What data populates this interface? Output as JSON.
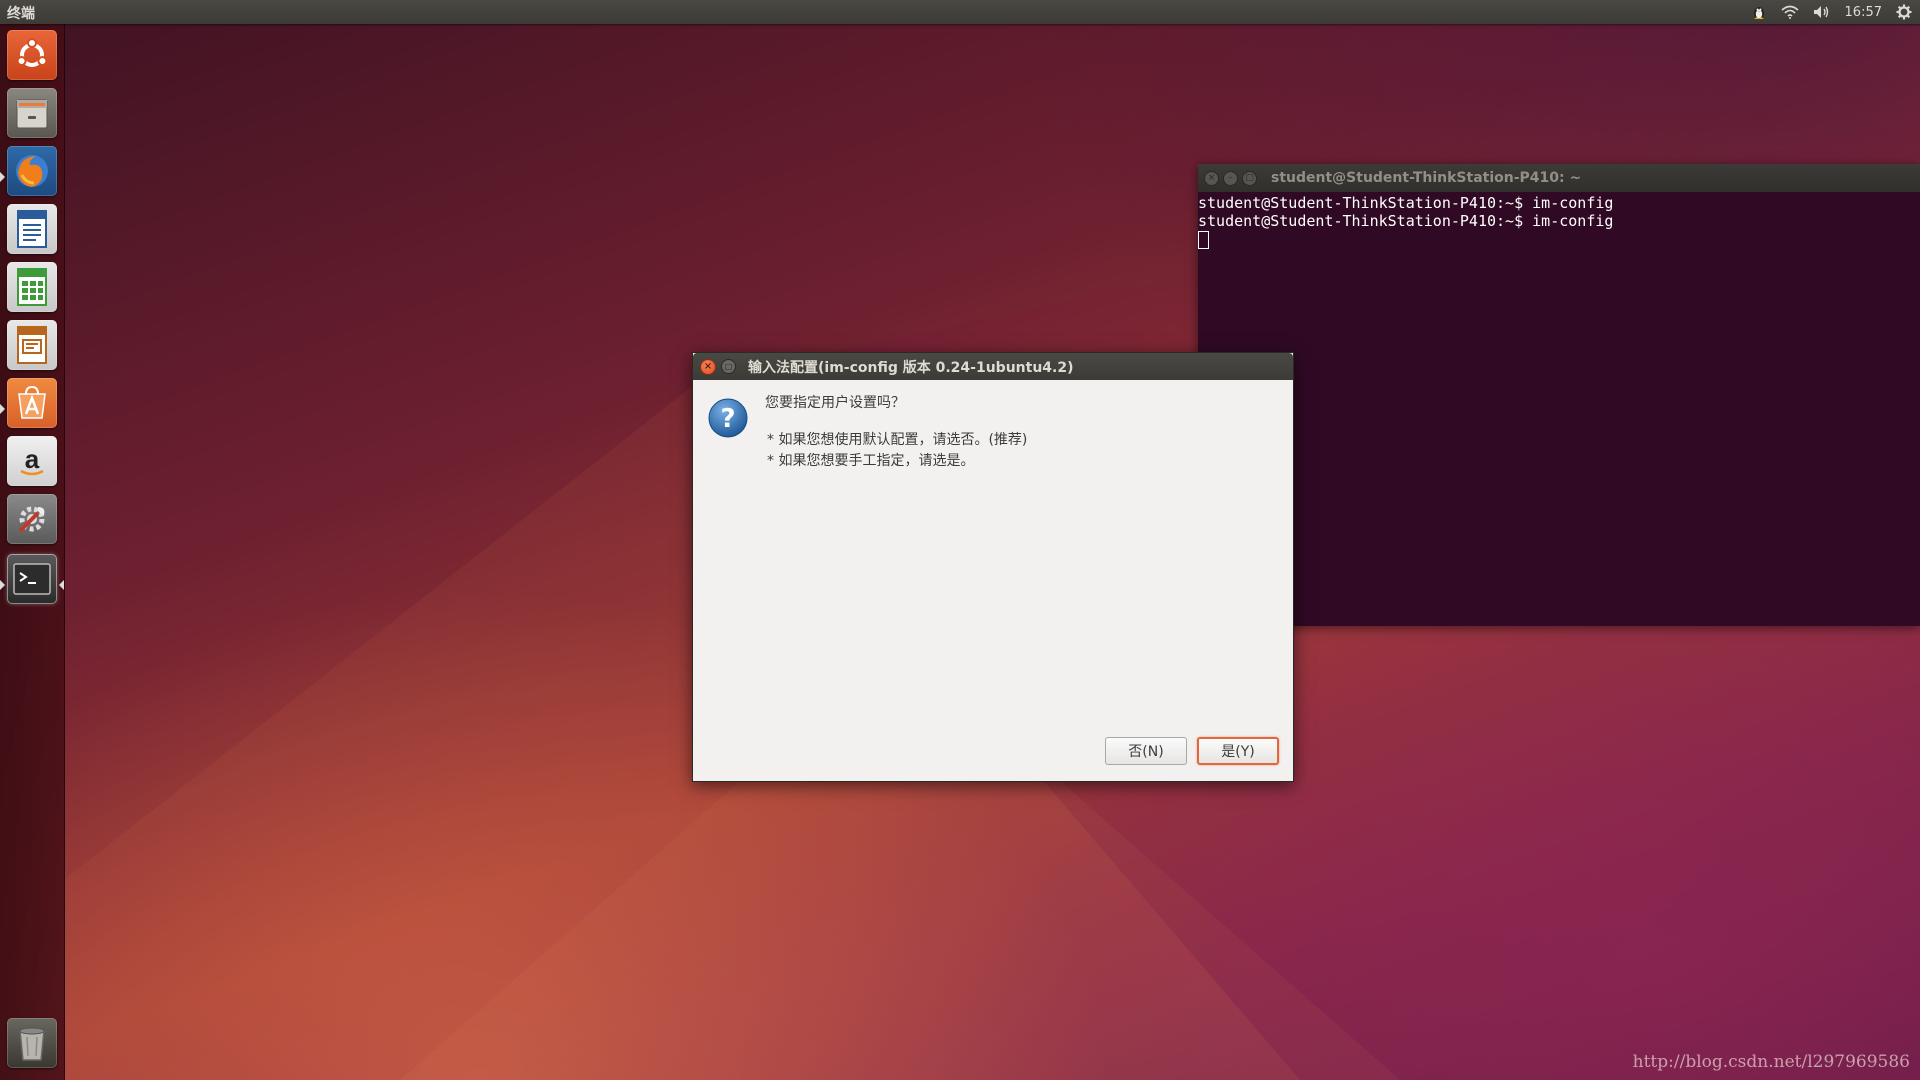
{
  "top_panel": {
    "app_title": "终端",
    "indicators": [
      "keyboard-tux-icon",
      "wifi-icon",
      "volume-icon",
      "gear-icon"
    ],
    "clock": "16:57"
  },
  "launcher": {
    "items": [
      {
        "name": "ubuntu-dash",
        "icon": "ubuntu-logo-icon",
        "color": "#e05a2a"
      },
      {
        "name": "files",
        "icon": "file-cabinet-icon",
        "color": "#c9c5bd"
      },
      {
        "name": "firefox",
        "icon": "firefox-icon",
        "color": "#2d6fb4"
      },
      {
        "name": "writer",
        "icon": "writer-document-icon",
        "color": "#2a5c9a"
      },
      {
        "name": "calc",
        "icon": "calc-spreadsheet-icon",
        "color": "#3f9a3a"
      },
      {
        "name": "impress",
        "icon": "impress-presentation-icon",
        "color": "#b8651e"
      },
      {
        "name": "software-center",
        "icon": "software-center-icon",
        "color": "#e0742a"
      },
      {
        "name": "amazon",
        "icon": "amazon-icon",
        "color": "#e6e6e6"
      },
      {
        "name": "system-settings",
        "icon": "settings-wrench-icon",
        "color": "#7a7a7a"
      },
      {
        "name": "terminal",
        "icon": "terminal-icon",
        "color": "#2c2c2c"
      }
    ],
    "trash_icon": "trash-icon"
  },
  "terminal": {
    "title": "student@Student-ThinkStation-P410: ~",
    "lines": [
      "student@Student-ThinkStation-P410:~$ im-config",
      "student@Student-ThinkStation-P410:~$ im-config"
    ]
  },
  "dialog": {
    "title": "输入法配置(im-config 版本 0.24-1ubuntu4.2)",
    "icon": "question-icon",
    "question": "您要指定用户设置吗？",
    "bullet1": "* 如果您想使用默认配置，请选否。(推荐)",
    "bullet2": "* 如果您想要手工指定，请选是。",
    "no_button": "否(N)",
    "yes_button": "是(Y)"
  },
  "watermark": "http://blog.csdn.net/l297969586",
  "colors": {
    "accent": "#e1683c",
    "terminal_bg": "#300a24",
    "panel_bg": "#3c3b37"
  }
}
